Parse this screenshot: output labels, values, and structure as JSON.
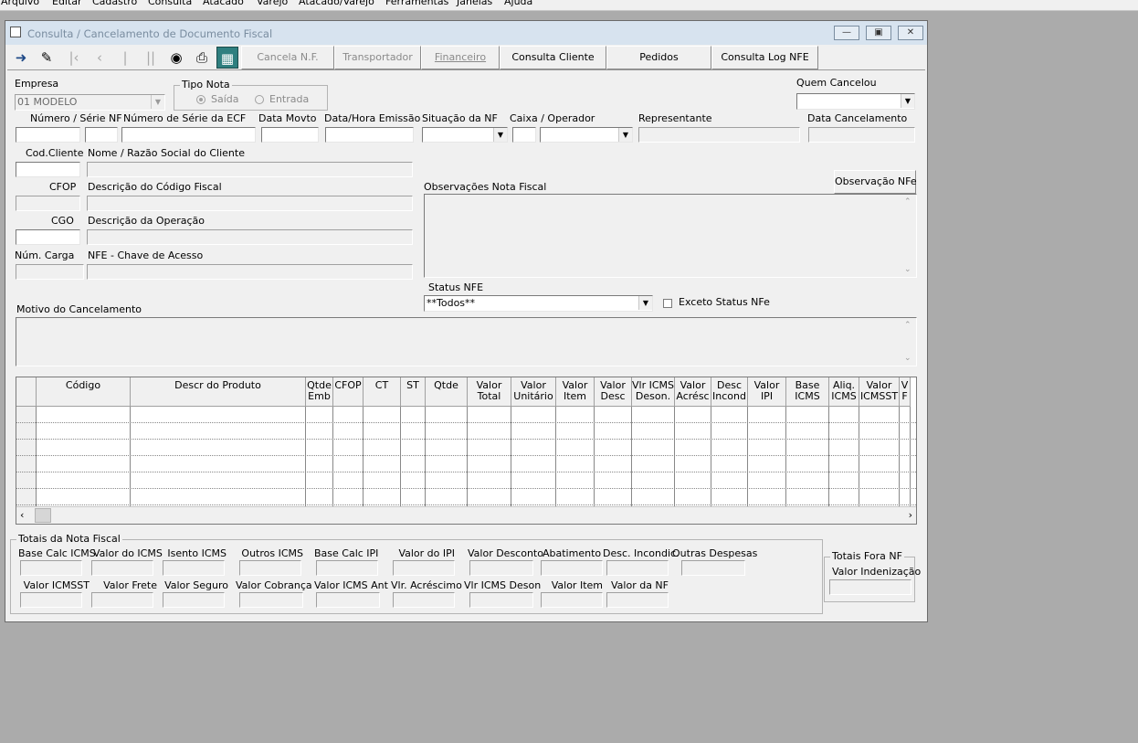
{
  "menu": [
    "Arquivo",
    "Editar",
    "Cadastro",
    "Consulta",
    "Atacado",
    "Varejo",
    "Atacado/Varejo",
    "Ferramentas",
    "Janelas",
    "Ajuda"
  ],
  "window": {
    "title": "Consulta / Cancelamento de Documento Fiscal"
  },
  "toolbar": {
    "cancela": "Cancela N.F.",
    "transportador": "Transportador",
    "financeiro": "Financeiro",
    "consulta_cliente": "Consulta Cliente",
    "pedidos": "Pedidos",
    "consulta_log": "Consulta Log NFE"
  },
  "form": {
    "empresa_label": "Empresa",
    "empresa_value": "01 MODELO",
    "tipo_nota_label": "Tipo Nota",
    "saida": "Saída",
    "entrada": "Entrada",
    "quem_cancelou": "Quem Cancelou",
    "numero_serie": "Número / Série NF",
    "numero_serie_ecf": "Número de Série da ECF",
    "data_movto": "Data Movto",
    "data_hora_emissao": "Data/Hora Emissão",
    "situacao_nf": "Situação da NF",
    "caixa_operador": "Caixa / Operador",
    "representante": "Representante",
    "data_cancelamento": "Data Cancelamento",
    "cod_cliente": "Cod.Cliente",
    "nome_cliente": "Nome / Razão Social do Cliente",
    "cfop": "CFOP",
    "desc_cfop": "Descrição do Código Fiscal",
    "observacoes": "Observações Nota Fiscal",
    "observacao_btn": "Observação NFe",
    "cgo": "CGO",
    "desc_operacao": "Descrição da Operação",
    "num_carga": "Núm. Carga",
    "chave_acesso": "NFE - Chave de Acesso",
    "status_nfe": "Status NFE",
    "status_value": "**Todos**",
    "exceto_status": "Exceto Status NFe",
    "motivo": "Motivo do Cancelamento"
  },
  "grid": {
    "columns": [
      [
        "Código"
      ],
      [
        "Descr do Produto"
      ],
      [
        "Qtde",
        "Emb"
      ],
      [
        "CFOP"
      ],
      [
        "CT"
      ],
      [
        "ST"
      ],
      [
        "Qtde"
      ],
      [
        "Valor",
        "Total"
      ],
      [
        "Valor",
        "Unitário"
      ],
      [
        "Valor",
        "Item"
      ],
      [
        "Valor",
        "Desc"
      ],
      [
        "Vlr ICMS",
        "Deson."
      ],
      [
        "Valor",
        "Acrésc"
      ],
      [
        "Desc",
        "Incond"
      ],
      [
        "Valor",
        "IPI"
      ],
      [
        "Base",
        "ICMS"
      ],
      [
        "Aliq.",
        "ICMS"
      ],
      [
        "Valor",
        "ICMSST"
      ],
      [
        "V",
        "F"
      ]
    ]
  },
  "totais": {
    "title": "Totais da Nota Fiscal",
    "row1": [
      "Base Calc ICMS",
      "Valor do ICMS",
      "Isento ICMS",
      "Outros ICMS",
      "Base Calc IPI",
      "Valor do IPI",
      "Valor Desconto",
      "Abatimento",
      "Desc. Incondic.",
      "Outras Despesas"
    ],
    "row2": [
      "Valor ICMSST",
      "Valor Frete",
      "Valor Seguro",
      "Valor Cobrança",
      "Valor ICMS Ant",
      "Vlr. Acréscimo",
      "Vlr ICMS Deson",
      "Valor Item",
      "Valor da NF"
    ]
  },
  "totais_fora": {
    "title": "Totais Fora NF",
    "indenizacao": "Valor Indenização"
  }
}
